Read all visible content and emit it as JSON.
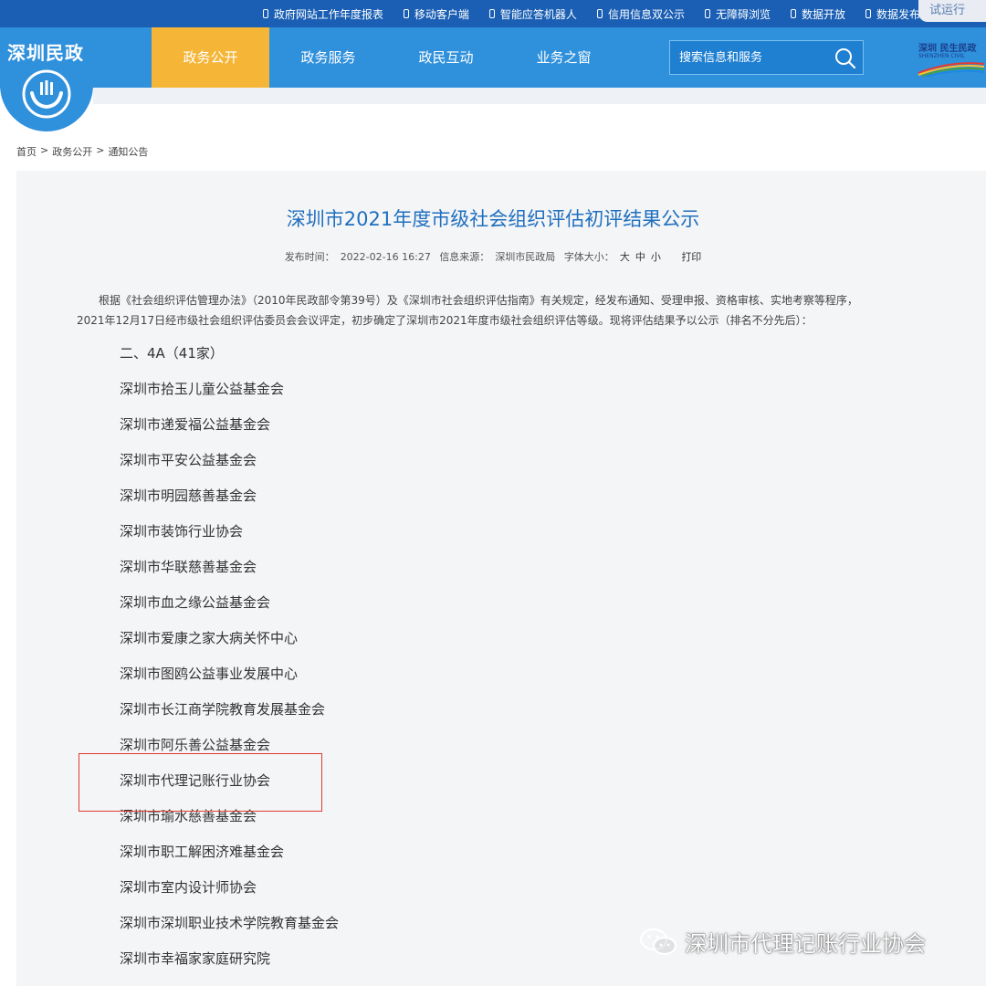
{
  "topbar": {
    "links": [
      "政府网站工作年度报表",
      "移动客户端",
      "智能应答机器人",
      "信用信息双公示",
      "无障碍浏览",
      "数据开放",
      "数据发布"
    ],
    "trial_label": "试运行"
  },
  "header": {
    "logo_text": "深圳民政",
    "nav": [
      "政务公开",
      "政务服务",
      "政民互动",
      "业务之窗"
    ],
    "active_nav": "政务公开",
    "search_placeholder": "搜索信息和服务",
    "brand_text": "深圳 民生民政",
    "brand_sub": "SHENZHEN CIVIL"
  },
  "breadcrumb": [
    "首页",
    ">",
    "政务公开",
    ">",
    "通知公告"
  ],
  "article": {
    "title": "深圳市2021年度市级社会组织评估初评结果公示",
    "meta": {
      "publish_label": "发布时间：",
      "publish_time": "2022-02-16 16:27",
      "source_label": "信息来源：",
      "source": "深圳市民政局",
      "font_label": "字体大小：",
      "font_large": "大",
      "font_medium": "中",
      "font_small": "小",
      "print": "打印"
    },
    "intro_line1": "根据《社会组织评估管理办法》（2010年民政部令第39号）及《深圳市社会组织评估指南》有关规定，经发布通知、受理申报、资格审核、实地考察等程序，",
    "intro_line2": "2021年12月17日经市级社会组织评估委员会会议评定，初步确定了深圳市2021年度市级社会组织评估等级。现将评估结果予以公示（排名不分先后）：",
    "section": "二、4A（41家）",
    "orgs": [
      "深圳市拾玉儿童公益基金会",
      "深圳市递爱福公益基金会",
      "深圳市平安公益基金会",
      "深圳市明园慈善基金会",
      "深圳市装饰行业协会",
      "深圳市华联慈善基金会",
      "深圳市血之缘公益基金会",
      "深圳市爱康之家大病关怀中心",
      "深圳市图鸥公益事业发展中心",
      "深圳市长江商学院教育发展基金会",
      "深圳市阿乐善公益基金会",
      "深圳市代理记账行业协会",
      "深圳市瑜水慈善基金会",
      "深圳市职工解困济难基金会",
      "深圳市室内设计师协会",
      "深圳市深圳职业技术学院教育基金会",
      "深圳市幸福家家庭研究院"
    ]
  },
  "watermark": "深圳市代理记账行业协会",
  "colors": {
    "topbar": "#1a5fb4",
    "header": "#2f90dc",
    "active_nav": "#f5b537",
    "title": "#1f6fbf",
    "highlight": "#e03a2f"
  }
}
